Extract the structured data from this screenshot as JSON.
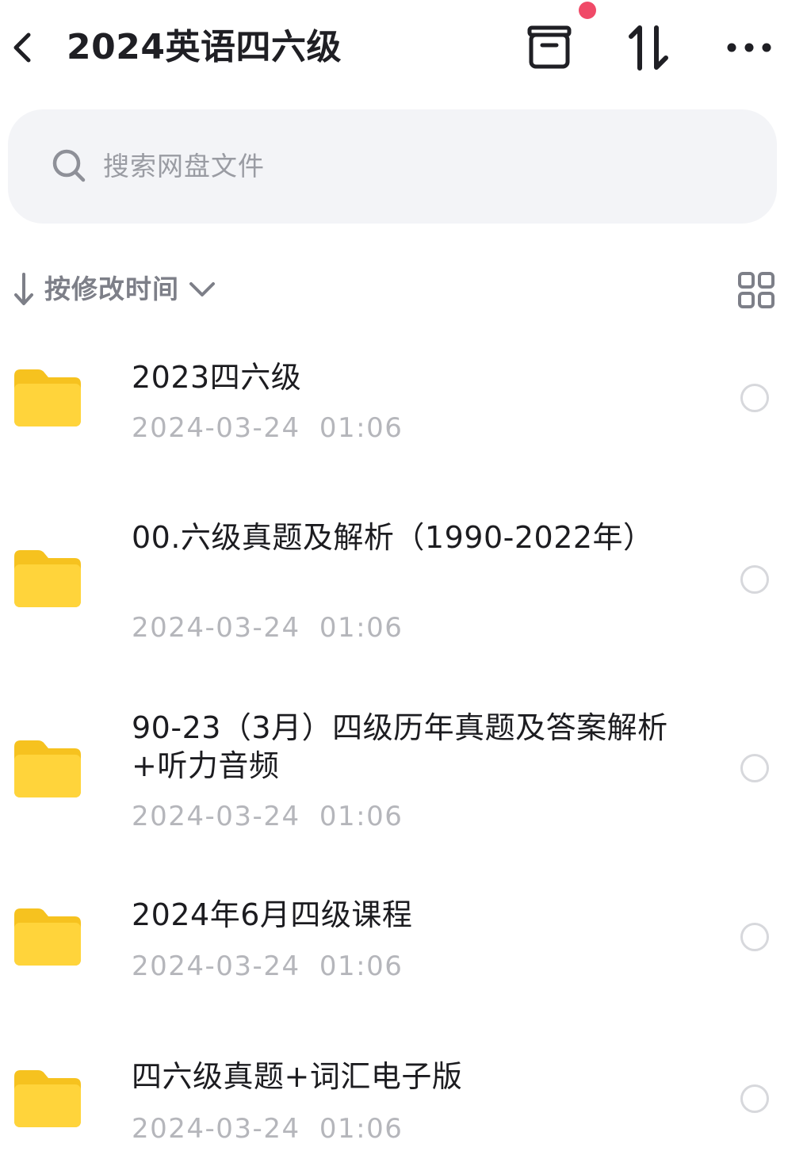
{
  "header": {
    "title": "2024英语四六级",
    "back_icon": "chevron-left-icon",
    "actions": [
      "archive-box-icon",
      "sort-updown-icon",
      "more-dots-icon"
    ],
    "notification_dot_color": "#f04a68"
  },
  "search": {
    "placeholder": "搜索网盘文件"
  },
  "sort": {
    "label": "按修改时间",
    "direction": "descending",
    "view_toggle_icon": "grid-view-icon"
  },
  "files": [
    {
      "name": "2023四六级",
      "date": "2024-03-24 01:06",
      "type": "folder"
    },
    {
      "name": "00.六级真题及解析（1990-2022年）",
      "date": "2024-03-24 01:06",
      "type": "folder"
    },
    {
      "name": "90-23（3月）四级历年真题及答案解析+听力音频",
      "date": "2024-03-24 01:06",
      "type": "folder"
    },
    {
      "name": "2024年6月四级课程",
      "date": "2024-03-24 01:06",
      "type": "folder"
    },
    {
      "name": "四六级真题+词汇电子版",
      "date": "2024-03-24 01:06",
      "type": "folder"
    }
  ],
  "colors": {
    "folder": "#ffd43b",
    "search_bg": "#f3f4f7",
    "muted_text": "#b5b6bb"
  }
}
